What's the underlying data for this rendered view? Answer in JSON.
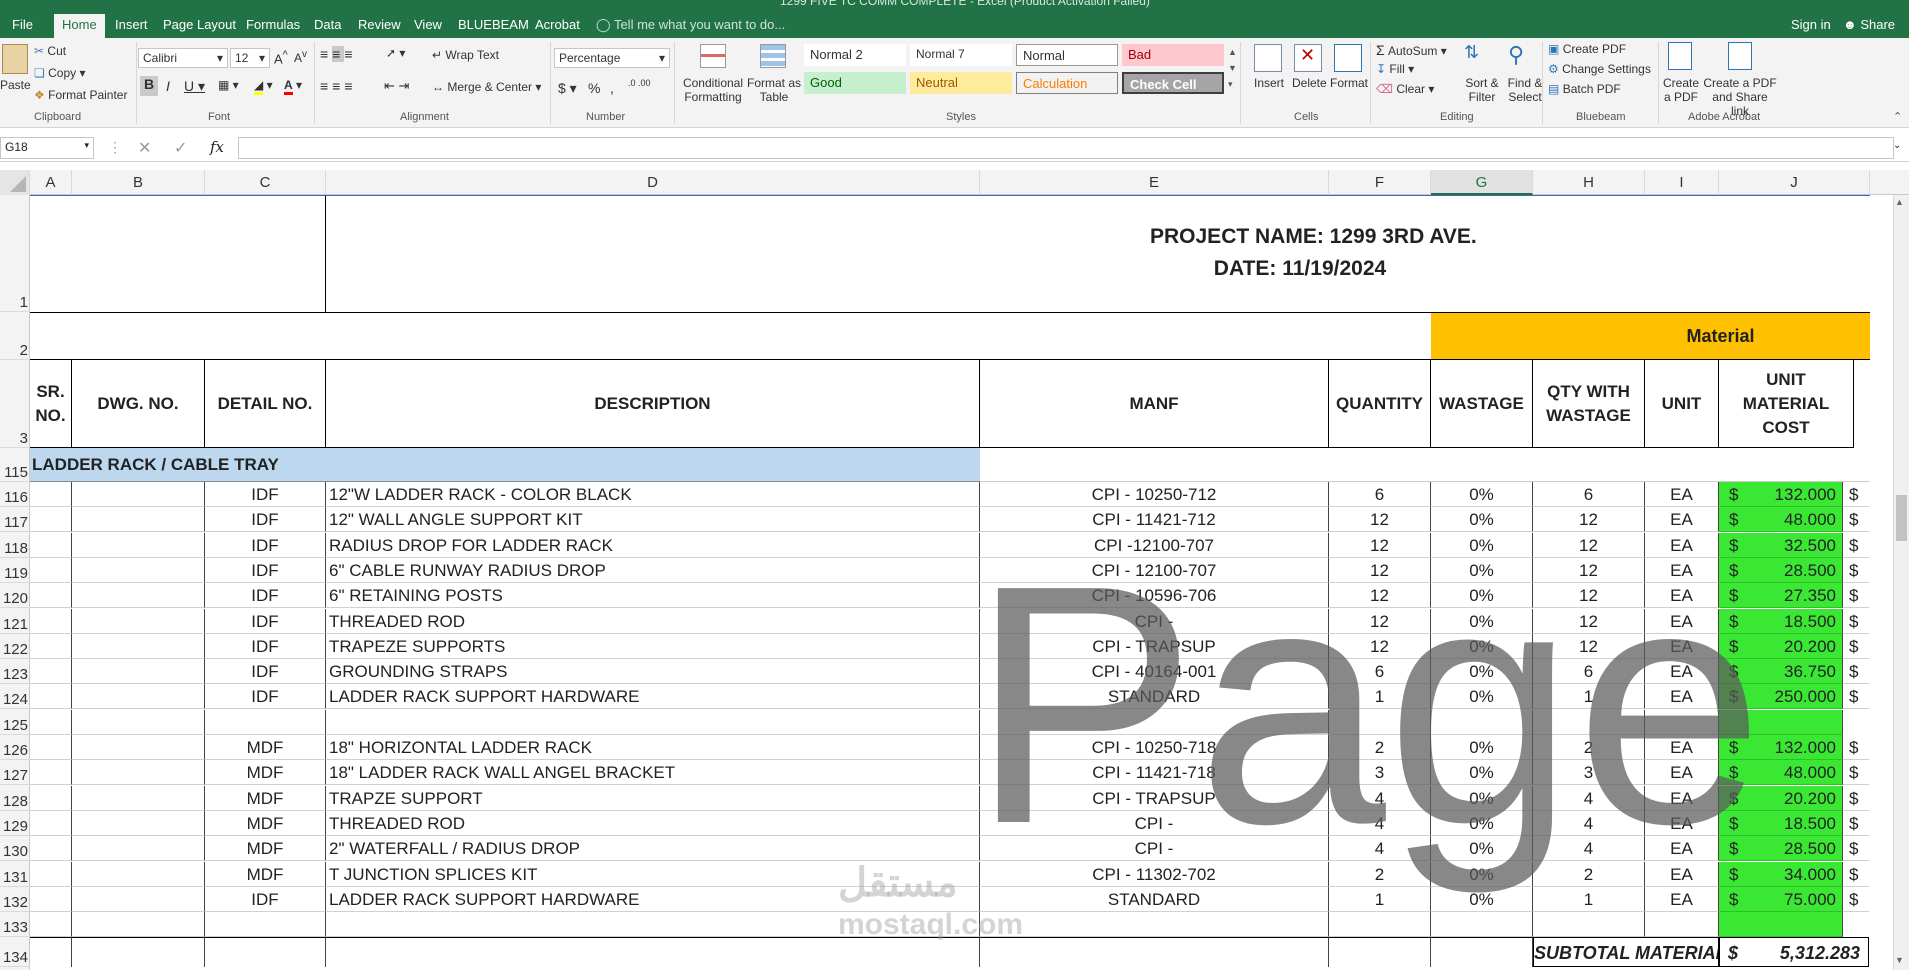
{
  "window": {
    "title": "1299 FIVE TC COMM COMPLETE - Excel (Product Activation Failed)"
  },
  "tabs": [
    "File",
    "Home",
    "Insert",
    "Page Layout",
    "Formulas",
    "Data",
    "Review",
    "View",
    "BLUEBEAM",
    "Acrobat"
  ],
  "tell_me": "Tell me what you want to do...",
  "account": {
    "signin": "Sign in",
    "share": "Share"
  },
  "ribbon": {
    "clipboard": {
      "paste": "Paste",
      "cut": "Cut",
      "copy": "Copy",
      "format_painter": "Format Painter",
      "label": "Clipboard"
    },
    "font": {
      "name": "Calibri",
      "size": "12",
      "label": "Font"
    },
    "alignment": {
      "wrap": "Wrap Text",
      "merge": "Merge & Center",
      "label": "Alignment"
    },
    "number": {
      "format": "Percentage",
      "currency": "$",
      "percent": "%",
      "comma": ",",
      "label": "Number"
    },
    "cond_format": "Conditional Formatting",
    "format_table": "Format as Table",
    "styles": {
      "normal2": "Normal 2",
      "normal7": "Normal 7",
      "normal": "Normal",
      "bad": "Bad",
      "good": "Good",
      "neutral": "Neutral",
      "calculation": "Calculation",
      "check": "Check Cell",
      "label": "Styles"
    },
    "cells": {
      "insert": "Insert",
      "delete": "Delete",
      "format": "Format",
      "label": "Cells"
    },
    "editing": {
      "autosum": "AutoSum",
      "fill": "Fill",
      "clear": "Clear",
      "sort": "Sort & Filter",
      "find": "Find & Select",
      "label": "Editing"
    },
    "bluebeam": {
      "create": "Create PDF",
      "change": "Change Settings",
      "batch": "Batch PDF",
      "label": "Bluebeam"
    },
    "acrobat": {
      "create": "Create a PDF",
      "share": "Create a PDF and Share link",
      "label": "Adobe Acrobat"
    }
  },
  "formula_bar": {
    "name_box": "G18",
    "fx": "fx",
    "value": ""
  },
  "columns": [
    "A",
    "B",
    "C",
    "D",
    "E",
    "F",
    "G",
    "H",
    "I",
    "J"
  ],
  "selected_column": "G",
  "sheet": {
    "project_name": "PROJECT NAME:  1299 3RD AVE.",
    "date": "DATE: 11/19/2024",
    "material_label": "Material",
    "headers": {
      "sr": "SR. NO.",
      "dwg": "DWG. NO.",
      "detail": "DETAIL NO.",
      "desc": "DESCRIPTION",
      "manf": "MANF",
      "qty": "QUANTITY",
      "wastage": "WASTAGE",
      "qtyw": "QTY WITH WASTAGE",
      "unit": "UNIT",
      "umc": "UNIT MATERIAL COST"
    },
    "section_title": "LADDER RACK  / CABLE TRAY",
    "rows": [
      {
        "n": "116",
        "detail": "IDF",
        "desc": "12\"W LADDER RACK - COLOR BLACK",
        "manf": "CPI - 10250-712",
        "qty": "6",
        "waste": "0%",
        "qtyw": "6",
        "unit": "EA",
        "cur": "$",
        "cost": "132.000"
      },
      {
        "n": "117",
        "detail": "IDF",
        "desc": "12\" WALL ANGLE SUPPORT KIT",
        "manf": "CPI - 11421-712",
        "qty": "12",
        "waste": "0%",
        "qtyw": "12",
        "unit": "EA",
        "cur": "$",
        "cost": "48.000"
      },
      {
        "n": "118",
        "detail": "IDF",
        "desc": "RADIUS DROP FOR LADDER RACK",
        "manf": "CPI -12100-707",
        "qty": "12",
        "waste": "0%",
        "qtyw": "12",
        "unit": "EA",
        "cur": "$",
        "cost": "32.500"
      },
      {
        "n": "119",
        "detail": "IDF",
        "desc": "6\" CABLE RUNWAY RADIUS DROP",
        "manf": "CPI - 12100-707",
        "qty": "12",
        "waste": "0%",
        "qtyw": "12",
        "unit": "EA",
        "cur": "$",
        "cost": "28.500"
      },
      {
        "n": "120",
        "detail": "IDF",
        "desc": "6\" RETAINING POSTS",
        "manf": "CPI - 10596-706",
        "qty": "12",
        "waste": "0%",
        "qtyw": "12",
        "unit": "EA",
        "cur": "$",
        "cost": "27.350"
      },
      {
        "n": "121",
        "detail": "IDF",
        "desc": "THREADED ROD",
        "manf": "CPI -",
        "qty": "12",
        "waste": "0%",
        "qtyw": "12",
        "unit": "EA",
        "cur": "$",
        "cost": "18.500"
      },
      {
        "n": "122",
        "detail": "IDF",
        "desc": "TRAPEZE SUPPORTS",
        "manf": "CPI - TRAPSUP",
        "qty": "12",
        "waste": "0%",
        "qtyw": "12",
        "unit": "EA",
        "cur": "$",
        "cost": "20.200"
      },
      {
        "n": "123",
        "detail": "IDF",
        "desc": "GROUNDING STRAPS",
        "manf": "CPI - 40164-001",
        "qty": "6",
        "waste": "0%",
        "qtyw": "6",
        "unit": "EA",
        "cur": "$",
        "cost": "36.750"
      },
      {
        "n": "124",
        "detail": "IDF",
        "desc": "LADDER RACK SUPPORT HARDWARE",
        "manf": "STANDARD",
        "qty": "1",
        "waste": "0%",
        "qtyw": "1",
        "unit": "EA",
        "cur": "$",
        "cost": "250.000"
      },
      {
        "n": "125",
        "detail": "",
        "desc": "",
        "manf": "",
        "qty": "",
        "waste": "",
        "qtyw": "",
        "unit": "",
        "cur": "",
        "cost": ""
      },
      {
        "n": "126",
        "detail": "MDF",
        "desc": "18\" HORIZONTAL LADDER RACK",
        "manf": "CPI - 10250-718",
        "qty": "2",
        "waste": "0%",
        "qtyw": "2",
        "unit": "EA",
        "cur": "$",
        "cost": "132.000"
      },
      {
        "n": "127",
        "detail": "MDF",
        "desc": "18\" LADDER RACK WALL ANGEL BRACKET",
        "manf": "CPI - 11421-718",
        "qty": "3",
        "waste": "0%",
        "qtyw": "3",
        "unit": "EA",
        "cur": "$",
        "cost": "48.000"
      },
      {
        "n": "128",
        "detail": "MDF",
        "desc": "TRAPZE SUPPORT",
        "manf": "CPI - TRAPSUP",
        "qty": "4",
        "waste": "0%",
        "qtyw": "4",
        "unit": "EA",
        "cur": "$",
        "cost": "20.200"
      },
      {
        "n": "129",
        "detail": "MDF",
        "desc": "THREADED ROD",
        "manf": "CPI -",
        "qty": "4",
        "waste": "0%",
        "qtyw": "4",
        "unit": "EA",
        "cur": "$",
        "cost": "18.500"
      },
      {
        "n": "130",
        "detail": "MDF",
        "desc": "2\" WATERFALL / RADIUS DROP",
        "manf": "CPI -",
        "qty": "4",
        "waste": "0%",
        "qtyw": "4",
        "unit": "EA",
        "cur": "$",
        "cost": "28.500"
      },
      {
        "n": "131",
        "detail": "MDF",
        "desc": "T JUNCTION SPLICES KIT",
        "manf": "CPI - 11302-702",
        "qty": "2",
        "waste": "0%",
        "qtyw": "2",
        "unit": "EA",
        "cur": "$",
        "cost": "34.000"
      },
      {
        "n": "132",
        "detail": "IDF",
        "desc": "LADDER RACK SUPPORT HARDWARE",
        "manf": "STANDARD",
        "qty": "1",
        "waste": "0%",
        "qtyw": "1",
        "unit": "EA",
        "cur": "$",
        "cost": "75.000"
      },
      {
        "n": "133",
        "detail": "",
        "desc": "",
        "manf": "",
        "qty": "",
        "waste": "",
        "qtyw": "",
        "unit": "",
        "cur": "",
        "cost": ""
      }
    ],
    "row_numbers_top": [
      "1",
      "2",
      "3",
      "115"
    ],
    "subtotal_row": "134",
    "subtotal_label": "SUBTOTAL MATERIAL",
    "subtotal_cur": "$",
    "subtotal_value": "5,312.283",
    "overflow_cur": "$"
  },
  "watermark": {
    "page": "Page",
    "site": "mostaql.com",
    "arabic": "مستقل"
  },
  "colors": {
    "excel_green": "#217346",
    "material_yellow": "#ffc000",
    "cost_green": "#3ae834",
    "section_blue": "#bdd7ee"
  }
}
